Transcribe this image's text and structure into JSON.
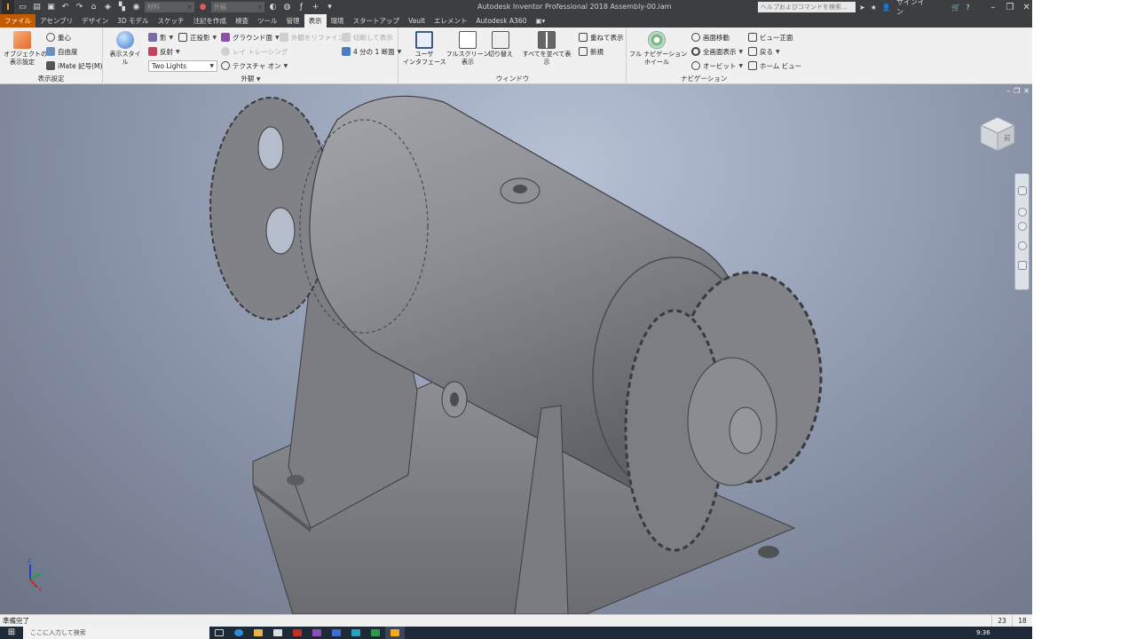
{
  "title_bar": {
    "logo_letter": "I",
    "doc_title": "Autodesk Inventor Professional 2018   Assembly-00.iam",
    "material_combo": "材料",
    "appearance_combo": "外観",
    "help_search_placeholder": "ヘルプおよびコマンドを検索...",
    "sign_in": "サインイン"
  },
  "tabs": [
    "ファイル",
    "アセンブリ",
    "デザイン",
    "3D モデル",
    "スケッチ",
    "注記を作成",
    "検査",
    "ツール",
    "管理",
    "表示",
    "環境",
    "スタートアップ",
    "Vault",
    "エレメント",
    "Autodesk A360"
  ],
  "active_tab_index": 9,
  "ribbon": {
    "display_settings": {
      "label": "表示設定",
      "object_visibility": "オブジェクトの\n表示設定",
      "center_of_gravity": "重心",
      "dof": "自由度",
      "imate_glyph": "iMate 記号(M)"
    },
    "appearance": {
      "label": "外観",
      "visual_style": "表示スタイル",
      "shadows": "影",
      "reflections": "反射",
      "lighting_value": "Two Lights",
      "orthographic": "正投影",
      "ground_plane": "グラウンド面",
      "ray_tracing": "レイ トレーシング",
      "textures": "テクスチャ オン",
      "refine_appearance": "外観をリファイン",
      "section_view": "切断して表示",
      "quarter_section": "4 分の 1 断面"
    },
    "windows": {
      "label": "ウィンドウ",
      "user_interface": "ユーザ\nインタフェース",
      "full_screen": "フルスクリーン\n表示",
      "switch": "切り替え",
      "arrange_all": "すべてを並べて表示",
      "cascade": "重ねて表示",
      "new": "新規"
    },
    "navigation": {
      "label": "ナビゲーション",
      "full_nav_wheel": "フル ナビゲーション\nホイール",
      "pan": "画面移動",
      "zoom_all": "全画面表示",
      "orbit": "オービット",
      "look_at": "ビュー正面",
      "back": "戻る",
      "home_view": "ホーム ビュー"
    }
  },
  "viewcube_label": "前",
  "statusbar": {
    "text": "準備完了",
    "occurrences": "23",
    "files_open": "18"
  },
  "taskbar": {
    "search_placeholder": "ここに入力して検索",
    "clock": "9:36"
  },
  "colors": {
    "titlebar": "#3c3f41",
    "file_tab": "#c45a00",
    "model_gray": "#7d7f84"
  }
}
